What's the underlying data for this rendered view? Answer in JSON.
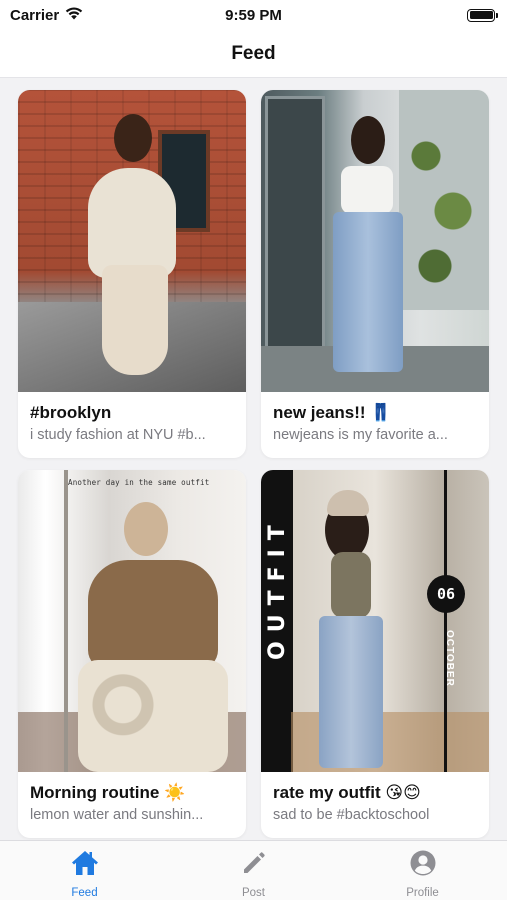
{
  "status_bar": {
    "carrier": "Carrier",
    "time": "9:59 PM"
  },
  "nav": {
    "title": "Feed"
  },
  "posts": [
    {
      "title": "#brooklyn",
      "subtitle": "i study fashion at NYU #b...",
      "image": "woman in cream sweater and satin skirt by brick wall"
    },
    {
      "title": "new jeans!! 👖",
      "subtitle": "newjeans is my favorite a...",
      "image": "woman in white crop top and ripped jeans"
    },
    {
      "title": "Morning routine ☀️",
      "subtitle": "lemon water and sunshin...",
      "image": "mirror selfie in brown sweater and tie-dye pants",
      "overlay_text": "Another day in the same outfit"
    },
    {
      "title": "rate my outfit 😘😊",
      "subtitle": "sad to be #backtoschool",
      "image": "mirror selfie in bucket hat and jeans",
      "overlay_text": "OUTFIT",
      "overlay_day": "06",
      "overlay_month": "OCTOBER"
    }
  ],
  "tabs": [
    {
      "label": "Feed",
      "icon": "house-icon",
      "active": true
    },
    {
      "label": "Post",
      "icon": "pencil-icon",
      "active": false
    },
    {
      "label": "Profile",
      "icon": "person-circle-icon",
      "active": false
    }
  ],
  "colors": {
    "accent": "#1f7ae0",
    "inactive": "#8e8e93"
  }
}
